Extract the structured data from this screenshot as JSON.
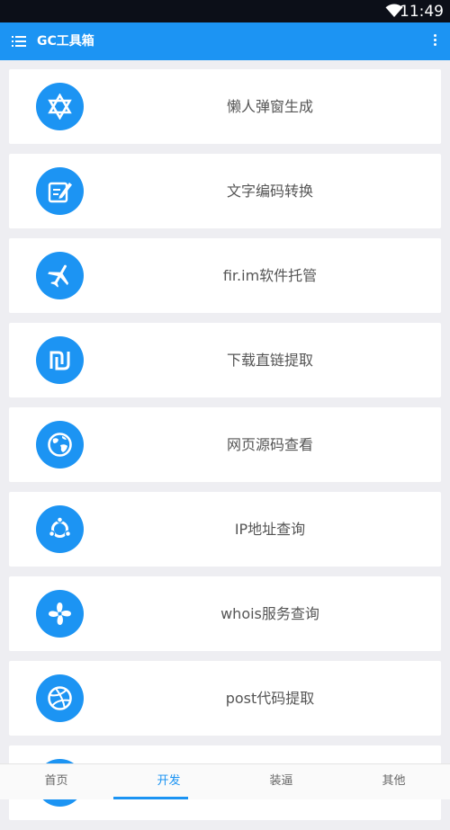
{
  "status_bar": {
    "time": "11:49",
    "wifi_icon": "wifi-icon"
  },
  "app_bar": {
    "title": "GC工具箱",
    "menu_icon": "list-menu-icon",
    "more_icon": "more-vert-icon"
  },
  "colors": {
    "accent": "#1c94f3",
    "background": "#eeeef2",
    "card": "#ffffff",
    "status_bar": "#0c0f18"
  },
  "tools": [
    {
      "label": "懒人弹窗生成",
      "icon": "star-of-david-icon"
    },
    {
      "label": "文字编码转换",
      "icon": "note-edit-icon"
    },
    {
      "label": "fir.im软件托管",
      "icon": "airplane-icon"
    },
    {
      "label": "下载直链提取",
      "icon": "shekel-icon"
    },
    {
      "label": "网页源码查看",
      "icon": "globe-icon"
    },
    {
      "label": "IP地址查询",
      "icon": "ubuntu-icon"
    },
    {
      "label": "whois服务查询",
      "icon": "fan-icon"
    },
    {
      "label": "post代码提取",
      "icon": "dribbble-icon"
    }
  ],
  "bottom_nav": {
    "tabs": [
      {
        "label": "首页"
      },
      {
        "label": "开发"
      },
      {
        "label": "装逼"
      },
      {
        "label": "其他"
      }
    ],
    "active_index": 1
  }
}
